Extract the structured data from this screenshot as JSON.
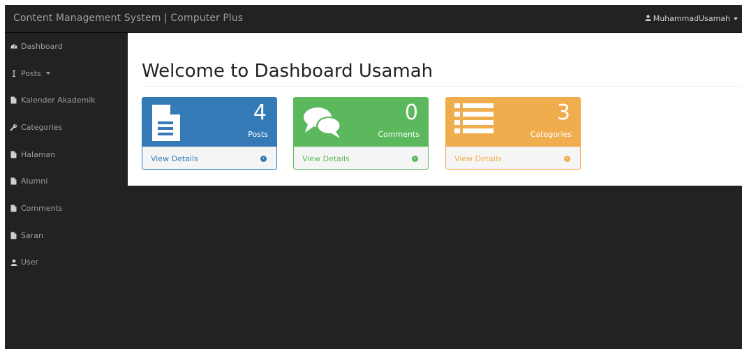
{
  "navbar": {
    "brand": "Content Management System | Computer Plus",
    "user_name": "MuhammadUsamah"
  },
  "sidebar": {
    "items": [
      {
        "label": "Dashboard",
        "icon": "dashboard-icon"
      },
      {
        "label": "Posts",
        "icon": "posts-icon",
        "has_caret": true
      },
      {
        "label": "Kalender Akademik",
        "icon": "file-icon"
      },
      {
        "label": "Categories",
        "icon": "wrench-icon"
      },
      {
        "label": "Halaman",
        "icon": "file-icon"
      },
      {
        "label": "Alumni",
        "icon": "file-icon"
      },
      {
        "label": "Comments",
        "icon": "file-icon"
      },
      {
        "label": "Saran",
        "icon": "file-icon"
      },
      {
        "label": "User",
        "icon": "user-icon"
      }
    ]
  },
  "main": {
    "title": "Welcome to Dashboard Usamah",
    "panels": [
      {
        "count": "4",
        "caption": "Posts",
        "link": "View Details",
        "icon": "document-icon",
        "color": "#337ab7"
      },
      {
        "count": "0",
        "caption": "Comments",
        "link": "View Details",
        "icon": "comments-icon",
        "color": "#5cb85c"
      },
      {
        "count": "3",
        "caption": "Categories",
        "link": "View Details",
        "icon": "list-icon",
        "color": "#f0ad4e"
      }
    ]
  }
}
